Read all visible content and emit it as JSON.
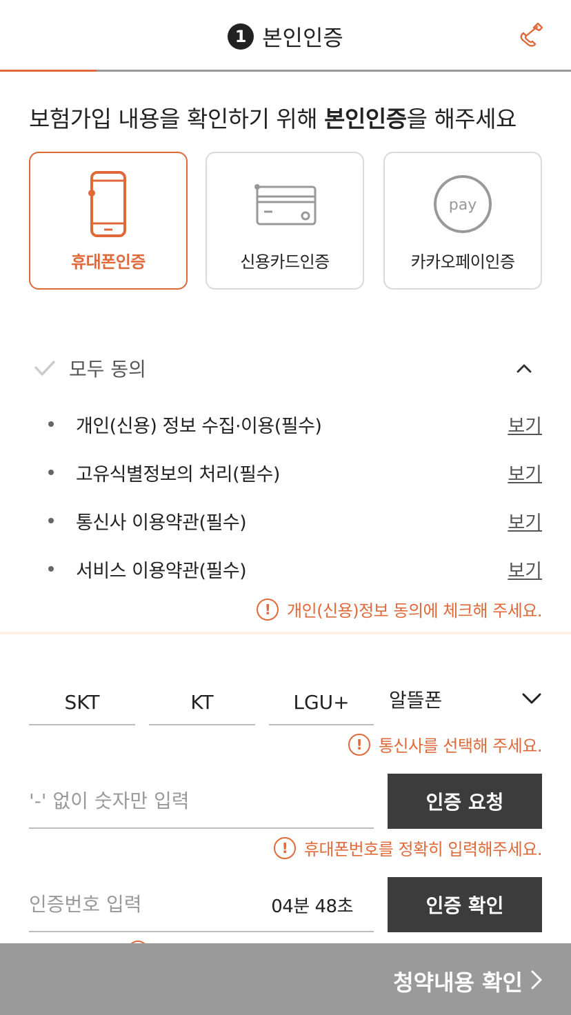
{
  "header": {
    "step_number": "1",
    "title": "본인인증"
  },
  "heading": {
    "prefix": "보험가입 내용을 확인하기 위해 ",
    "emphasis": "본인인증",
    "suffix": "을 해주세요"
  },
  "methods": [
    {
      "label": "휴대폰인증",
      "icon": "mobile-phone-icon",
      "selected": true
    },
    {
      "label": "신용카드인증",
      "icon": "credit-card-icon",
      "selected": false
    },
    {
      "label": "카카오페이인증",
      "icon": "pay-icon",
      "selected": false
    }
  ],
  "pay_icon_text": "pay",
  "agreement": {
    "all_label": "모두 동의",
    "terms": [
      {
        "label": "개인(신용) 정보 수집·이용(필수)",
        "view": "보기"
      },
      {
        "label": "고유식별정보의 처리(필수)",
        "view": "보기"
      },
      {
        "label": "통신사 이용약관(필수)",
        "view": "보기"
      },
      {
        "label": "서비스 이용약관(필수)",
        "view": "보기"
      }
    ],
    "warning": "개인(신용)정보 동의에 체크해 주세요."
  },
  "carrier": {
    "options": [
      "SKT",
      "KT",
      "LGU+"
    ],
    "mvno_label": "알뜰폰",
    "warning": "통신사를 선택해 주세요."
  },
  "phone": {
    "placeholder": "'-' 없이 숫자만 입력",
    "request_button": "인증 요청",
    "warning": "휴대폰번호를 정확히 입력해주세요."
  },
  "code": {
    "placeholder": "인증번호 입력",
    "timer": "04분 48초",
    "confirm_button": "인증 확인"
  },
  "warning_icon_text": "!",
  "bottom": {
    "label": "청약내용 확인"
  },
  "colors": {
    "accent": "#e0693a",
    "dark_button": "#3c3c3c",
    "bottom_bar": "#9a9a9a"
  }
}
